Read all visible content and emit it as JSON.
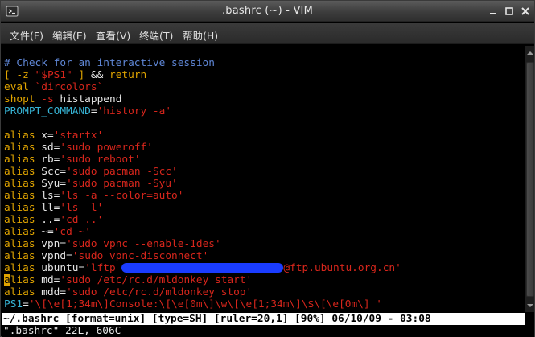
{
  "window": {
    "title": ".bashrc (~) - VIM"
  },
  "menu": {
    "items": [
      "文件(F)",
      "编辑(E)",
      "查看(V)",
      "终端(T)",
      "帮助(H)"
    ]
  },
  "editor": {
    "lines": {
      "l1": "# Check for an interactive session",
      "l2a": "[ -z ",
      "l2b": "\"$PS1\"",
      "l2c": " ] ",
      "l2d": "&&",
      "l2e": " return",
      "l3a": "eval ",
      "l3b": "`dircolors`",
      "l4a": "shopt ",
      "l4b": "-s",
      "l4c": " histappend",
      "l5a": "PROMPT_COMMAND",
      "l5b": "=",
      "l5c": "'history -a'",
      "a_x": "'startx'",
      "a_sd": "'sudo poweroff'",
      "a_rb": "'sudo reboot'",
      "a_Scc": "'sudo pacman -Scc'",
      "a_Syu": "'sudo pacman -Syu'",
      "a_ls": "'ls -a --color=auto'",
      "a_ll": "'ls -l'",
      "a_dd": "'cd ..'",
      "a_tilde": "'cd ~'",
      "a_vpn": "'sudo vpnc --enable-1des'",
      "a_vpnd": "'sudo vpnc-disconnect'",
      "a_ubuntu_pre": "'lftp ",
      "a_ubuntu_post": "@ftp.ubuntu.org.cn'",
      "a_md": "'sudo /etc/rc.d/mldonkey start'",
      "a_mdd": "'sudo /etc/rc.d/mldonkey stop'",
      "ps1": "'\\[\\e[1;34m\\]Console:\\[\\e[0m\\]\\w\\[\\e[1;34m\\]\\$\\[\\e[0m\\] '"
    },
    "keywords": {
      "alias": "alias",
      "n_x": " x",
      "n_sd": " sd",
      "n_rb": " rb",
      "n_Scc": " Scc",
      "n_Syu": " Syu",
      "n_ls": " ls",
      "n_ll": " ll",
      "n_dd": " ..",
      "n_tilde": " ~",
      "n_vpn": " vpn",
      "n_vpnd": " vpnd",
      "n_ubuntu": " ubuntu",
      "n_md": " md",
      "n_mdd": " mdd",
      "eq": "=",
      "ps1_name": "PS1",
      "cursor_char": "a",
      "cursor_rest": "lias"
    }
  },
  "status": {
    "line": "~/.bashrc [format=unix] [type=SH] [ruler=20,1] [90%] 06/10/09 - 03:08",
    "cmd": "\".bashrc\" 22L, 606C"
  },
  "colors": {
    "comment": "#5f87d7",
    "keyword": "#e0a400",
    "string": "#d7261c",
    "redaction": "#1a3cff"
  }
}
